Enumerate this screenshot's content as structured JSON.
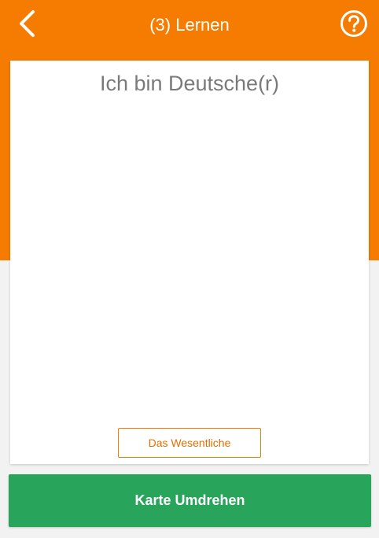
{
  "header": {
    "title": "(3) Lernen",
    "back_icon": "chevron-left-icon",
    "help_icon": "question-circle-icon"
  },
  "card": {
    "text": "Ich bin Deutsche(r)",
    "essential_label": "Das Wesentliche"
  },
  "actions": {
    "flip_label": "Karte Umdrehen"
  },
  "colors": {
    "accent": "#f57c00",
    "primary_button": "#28a55a",
    "background": "#f2f2f2"
  }
}
